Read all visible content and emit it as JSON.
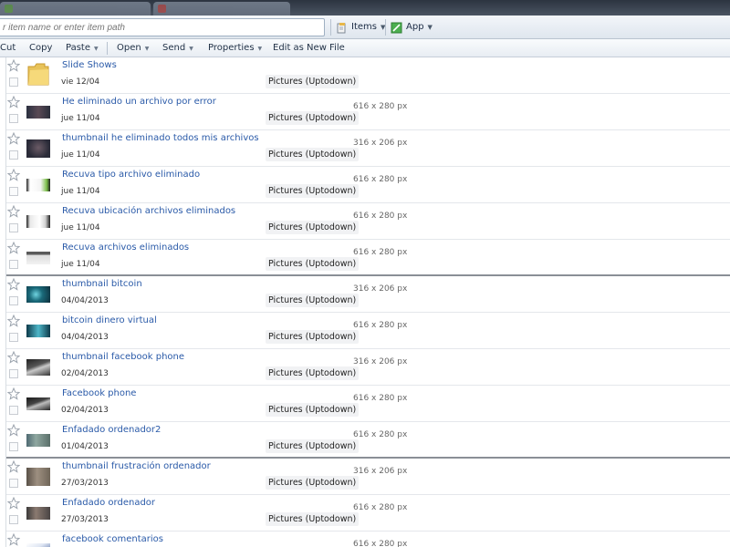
{
  "address_bar": {
    "placeholder": "r item name or enter item path",
    "items_label": "Items",
    "app_label": "App"
  },
  "toolbar": {
    "cut": "Cut",
    "copy": "Copy",
    "paste": "Paste",
    "open": "Open",
    "send": "Send",
    "properties": "Properties",
    "edit_as_new_file": "Edit as New File"
  },
  "items": [
    {
      "title": "Slide Shows",
      "date": "vie 12/04",
      "source": "Pictures (Uptodown)",
      "dims": "",
      "thumb": "folder-icon"
    },
    {
      "title": "He eliminado un archivo por error",
      "date": "jue 11/04",
      "source": "Pictures (Uptodown)",
      "dims": "616 x 280 px",
      "thumb": "image-thumbnail"
    },
    {
      "title": "thumbnail he eliminado todos mis archivos",
      "date": "jue 11/04",
      "source": "Pictures (Uptodown)",
      "dims": "316 x 206 px",
      "thumb": "image-thumbnail"
    },
    {
      "title": "Recuva tipo archivo eliminado",
      "date": "jue 11/04",
      "source": "Pictures (Uptodown)",
      "dims": "616 x 280 px",
      "thumb": "image-thumbnail"
    },
    {
      "title": "Recuva ubicación archivos eliminados",
      "date": "jue 11/04",
      "source": "Pictures (Uptodown)",
      "dims": "616 x 280 px",
      "thumb": "image-thumbnail"
    },
    {
      "title": "Recuva archivos eliminados",
      "date": "jue 11/04",
      "source": "Pictures (Uptodown)",
      "dims": "616 x 280 px",
      "thumb": "image-thumbnail"
    },
    {
      "title": "thumbnail bitcoin",
      "date": "04/04/2013",
      "source": "Pictures (Uptodown)",
      "dims": "316 x 206 px",
      "thumb": "image-thumbnail"
    },
    {
      "title": "bitcoin dinero virtual",
      "date": "04/04/2013",
      "source": "Pictures (Uptodown)",
      "dims": "616 x 280 px",
      "thumb": "image-thumbnail"
    },
    {
      "title": "thumbnail facebook phone",
      "date": "02/04/2013",
      "source": "Pictures (Uptodown)",
      "dims": "316 x 206 px",
      "thumb": "image-thumbnail"
    },
    {
      "title": "Facebook phone",
      "date": "02/04/2013",
      "source": "Pictures (Uptodown)",
      "dims": "616 x 280 px",
      "thumb": "image-thumbnail"
    },
    {
      "title": "Enfadado ordenador2",
      "date": "01/04/2013",
      "source": "Pictures (Uptodown)",
      "dims": "616 x 280 px",
      "thumb": "image-thumbnail"
    },
    {
      "title": "thumbnail frustración ordenador",
      "date": "27/03/2013",
      "source": "Pictures (Uptodown)",
      "dims": "316 x 206 px",
      "thumb": "image-thumbnail"
    },
    {
      "title": "Enfadado ordenador",
      "date": "27/03/2013",
      "source": "Pictures (Uptodown)",
      "dims": "616 x 280 px",
      "thumb": "image-thumbnail"
    },
    {
      "title": "facebook comentarios",
      "date": "",
      "source": "",
      "dims": "616 x 280 px",
      "thumb": "image-thumbnail"
    }
  ]
}
